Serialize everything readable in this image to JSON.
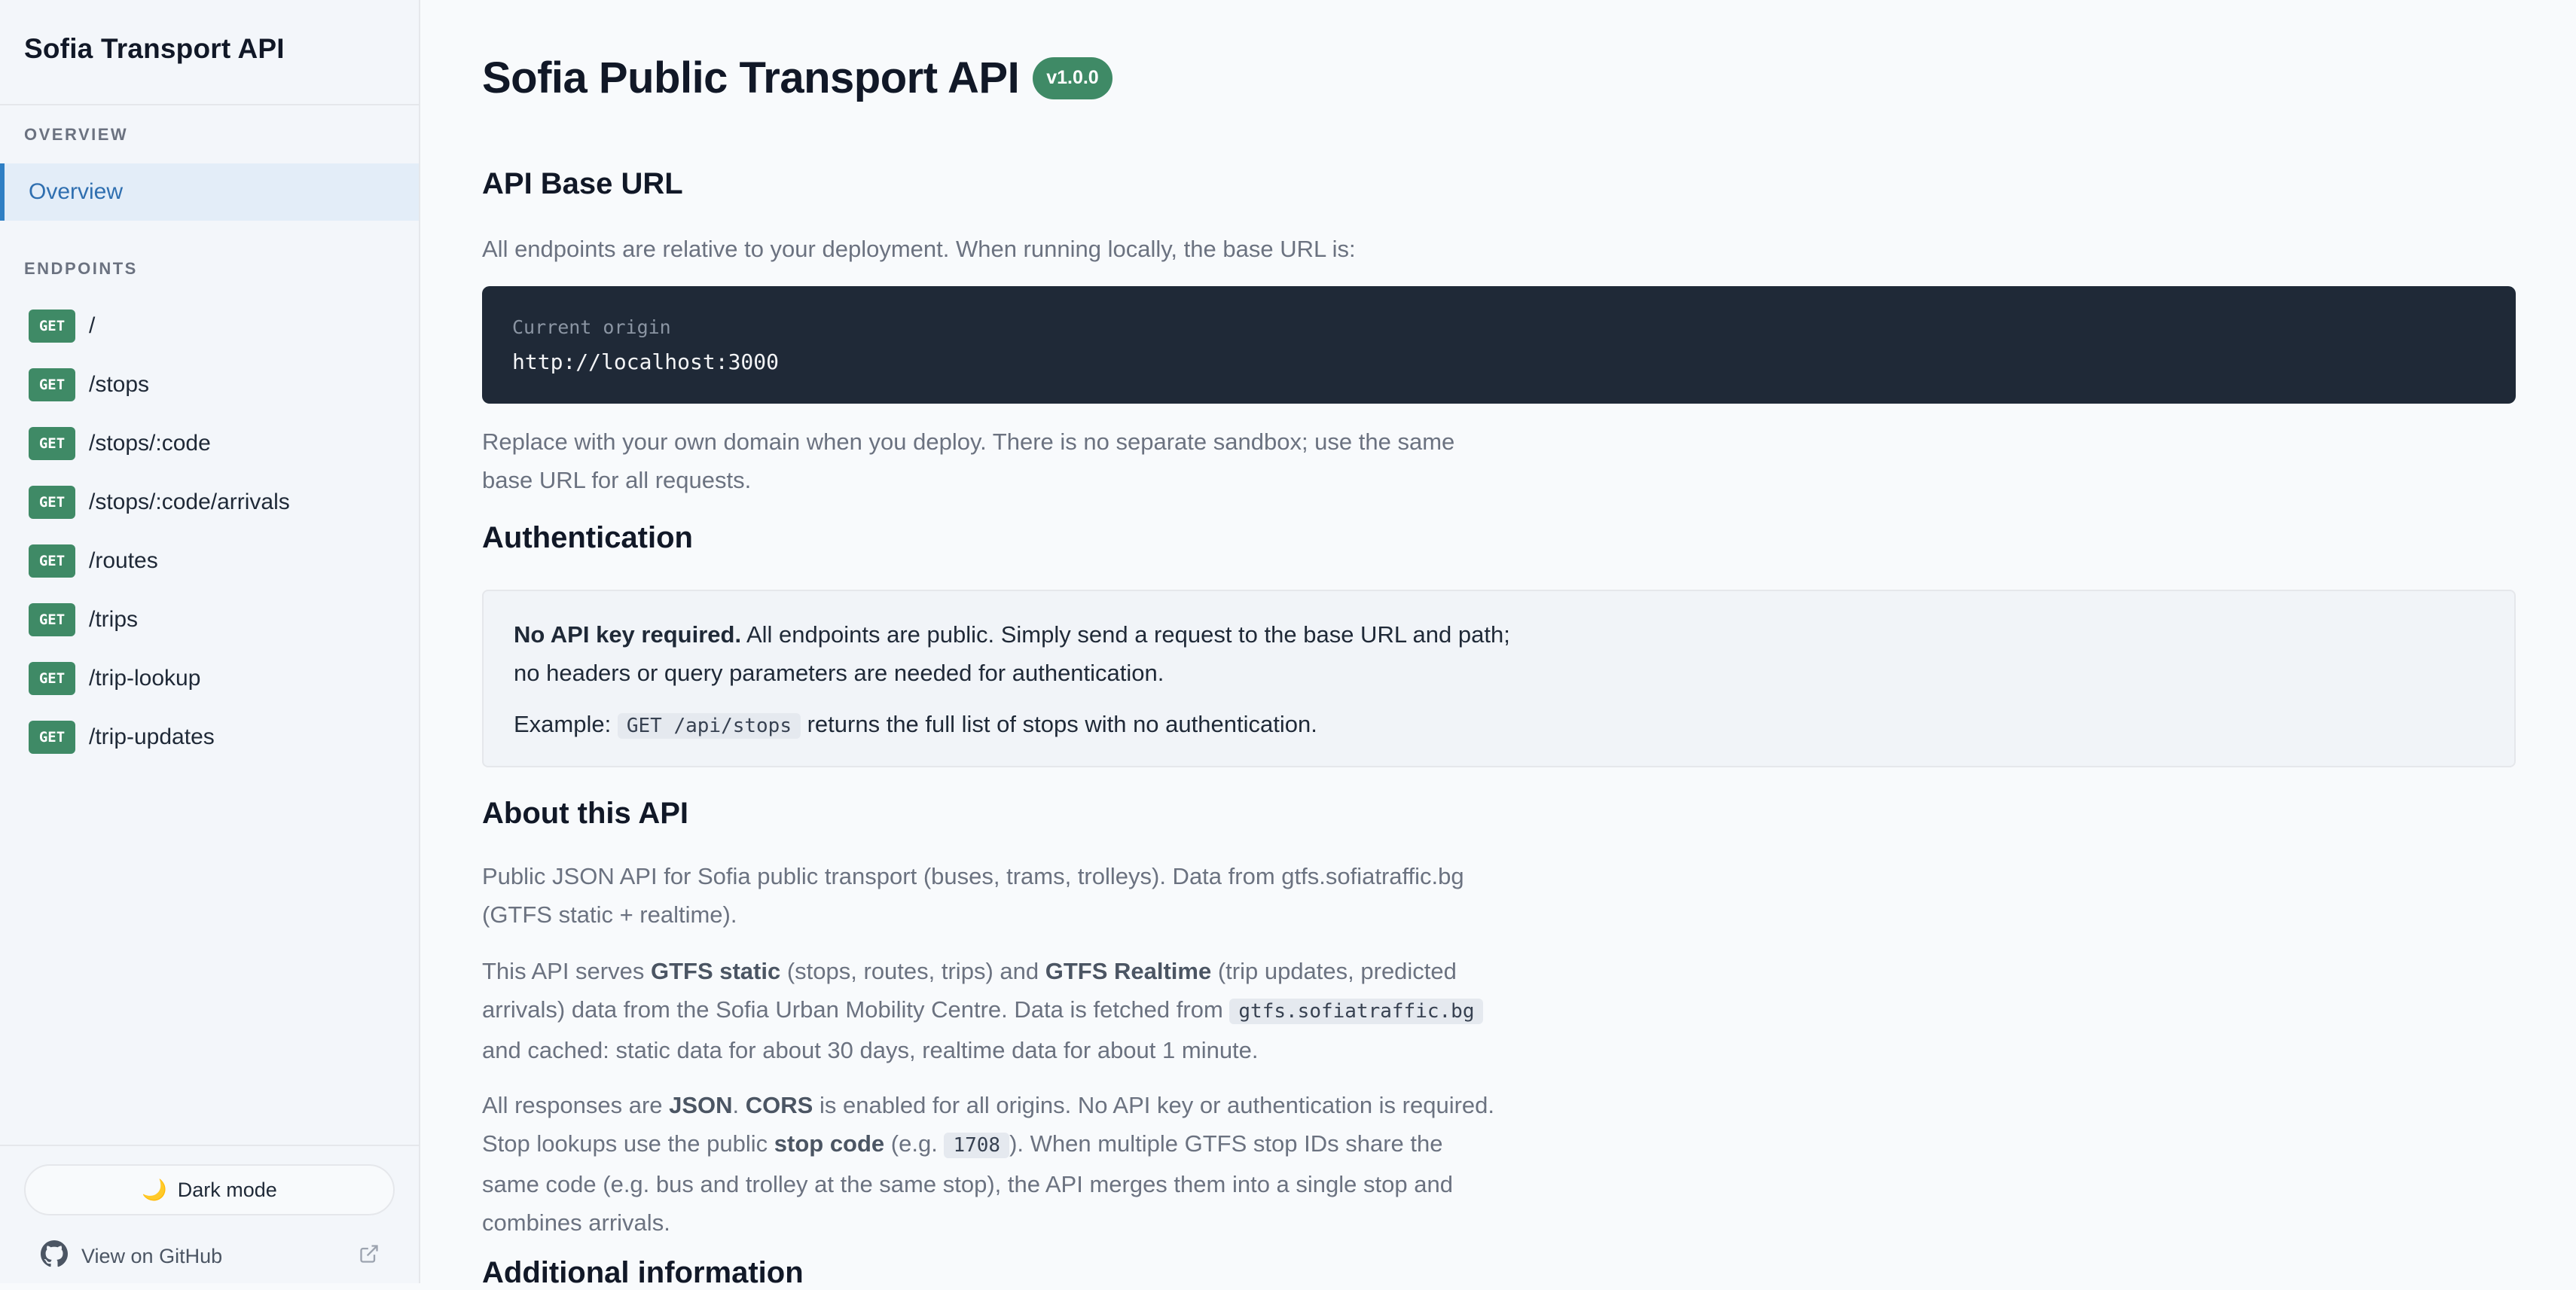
{
  "sidebar": {
    "title": "Sofia Transport API",
    "section_overview": "OVERVIEW",
    "overview_label": "Overview",
    "section_endpoints": "ENDPOINTS",
    "endpoints": [
      {
        "method": "GET",
        "path": "/"
      },
      {
        "method": "GET",
        "path": "/stops"
      },
      {
        "method": "GET",
        "path": "/stops/:code"
      },
      {
        "method": "GET",
        "path": "/stops/:code/arrivals"
      },
      {
        "method": "GET",
        "path": "/routes"
      },
      {
        "method": "GET",
        "path": "/trips"
      },
      {
        "method": "GET",
        "path": "/trip-lookup"
      },
      {
        "method": "GET",
        "path": "/trip-updates"
      }
    ],
    "dark_mode_icon": "moon-icon",
    "dark_mode_label": "Dark mode",
    "github_label": "View on GitHub",
    "github_icon": "github-icon",
    "external_icon": "external-link-icon"
  },
  "main": {
    "title": "Sofia Public Transport API",
    "version": "v1.0.0",
    "base_url_heading": "API Base URL",
    "base_url_intro": "All endpoints are relative to your deployment. When running locally, the base URL is:",
    "code_label": "Current origin",
    "code_url": "http://localhost:3000",
    "base_url_note_1": "Replace with your own domain when you deploy. There is no separate sandbox; use the same",
    "base_url_note_2": "base URL for all requests.",
    "auth_heading": "Authentication",
    "auth_bold": "No API key required.",
    "auth_text_1": " All endpoints are public. Simply send a request to the base URL and path;",
    "auth_text_2": "no headers or query parameters are needed for authentication.",
    "auth_example_prefix": "Example: ",
    "auth_example_code": "GET /api/stops",
    "auth_example_suffix": " returns the full list of stops with no authentication.",
    "about_heading": "About this API",
    "about_p1_line1": "Public JSON API for Sofia public transport (buses, trams, trolleys). Data from gtfs.sofiatraffic.bg",
    "about_p1_line2": "(GTFS static + realtime).",
    "about_p2_a": "This API serves ",
    "about_p2_b": "GTFS static",
    "about_p2_c": " (stops, routes, trips) and ",
    "about_p2_d": "GTFS Realtime",
    "about_p2_e": " (trip updates, predicted",
    "about_p2_line2_a": "arrivals) data from the Sofia Urban Mobility Centre. Data is fetched from ",
    "about_p2_code": "gtfs.sofiatraffic.bg",
    "about_p2_line3": "and cached: static data for about 30 days, realtime data for about 1 minute.",
    "about_p3_a": "All responses are ",
    "about_p3_b": "JSON",
    "about_p3_c": ". ",
    "about_p3_d": "CORS",
    "about_p3_e": " is enabled for all origins. No API key or authentication is required.",
    "about_p3_line2_a": "Stop lookups use the public ",
    "about_p3_line2_b": "stop code",
    "about_p3_line2_c": " (e.g. ",
    "about_p3_code": "1708",
    "about_p3_line2_d": "). When multiple GTFS stop IDs share the",
    "about_p3_line3": "same code (e.g. bus and trolley at the same stop), the API merges them into a single stop and",
    "about_p3_line4": "combines arrivals.",
    "additional_heading": "Additional information"
  }
}
